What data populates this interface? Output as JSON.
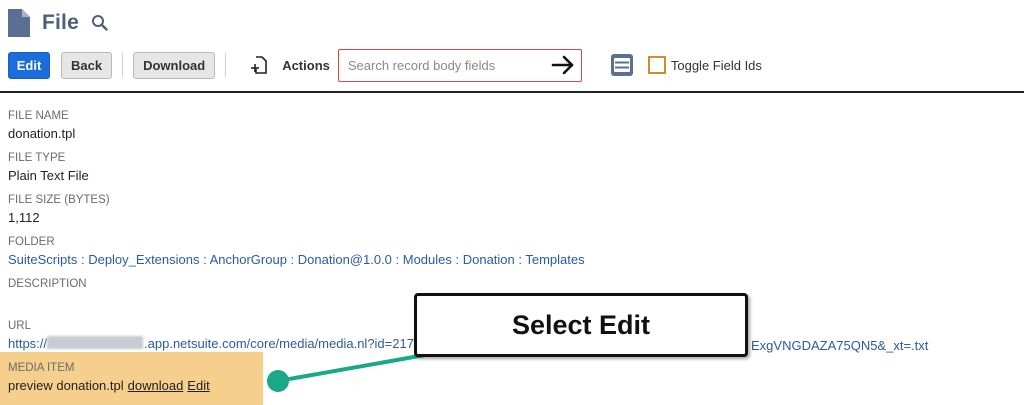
{
  "header": {
    "title": "File",
    "icon": "file-icon",
    "search_icon": "search-icon"
  },
  "toolbar": {
    "edit_label": "Edit",
    "back_label": "Back",
    "download_label": "Download",
    "new_icon": "new-document-icon",
    "actions_label": "Actions",
    "search_placeholder": "Search record body fields",
    "search_value": "",
    "submit_icon": "arrow-right-icon",
    "list_icon": "list-view-icon",
    "toggle_label": "Toggle Field Ids",
    "toggle_checked": false
  },
  "fields": {
    "file_name": {
      "label": "FILE NAME",
      "value": "donation.tpl"
    },
    "file_type": {
      "label": "FILE TYPE",
      "value": "Plain Text File"
    },
    "file_size": {
      "label": "FILE SIZE (BYTES)",
      "value": "1,112"
    },
    "folder": {
      "label": "FOLDER",
      "value": "SuiteScripts : Deploy_Extensions : AnchorGroup : Donation@1.0.0 : Modules : Donation : Templates"
    },
    "description": {
      "label": "DESCRIPTION",
      "value": ""
    },
    "url": {
      "label": "URL",
      "prefix": "https://",
      "value_start": ".app.netsuite.com/core/media/media.nl?id=2176627",
      "value_end": "ExgVNGDAZA75QN5&_xt=.txt"
    },
    "media_item": {
      "label": "MEDIA ITEM",
      "preview_text": "preview donation.tpl",
      "download_link": "download",
      "edit_link": "Edit"
    }
  },
  "callout": {
    "text": "Select Edit"
  },
  "colors": {
    "primary_button": "#1a6dda",
    "title": "#4d5f79",
    "link": "#2b5aa6",
    "highlight": "#f7cf8c",
    "callout_connector": "#1aa889",
    "search_border": "#e0453a"
  }
}
